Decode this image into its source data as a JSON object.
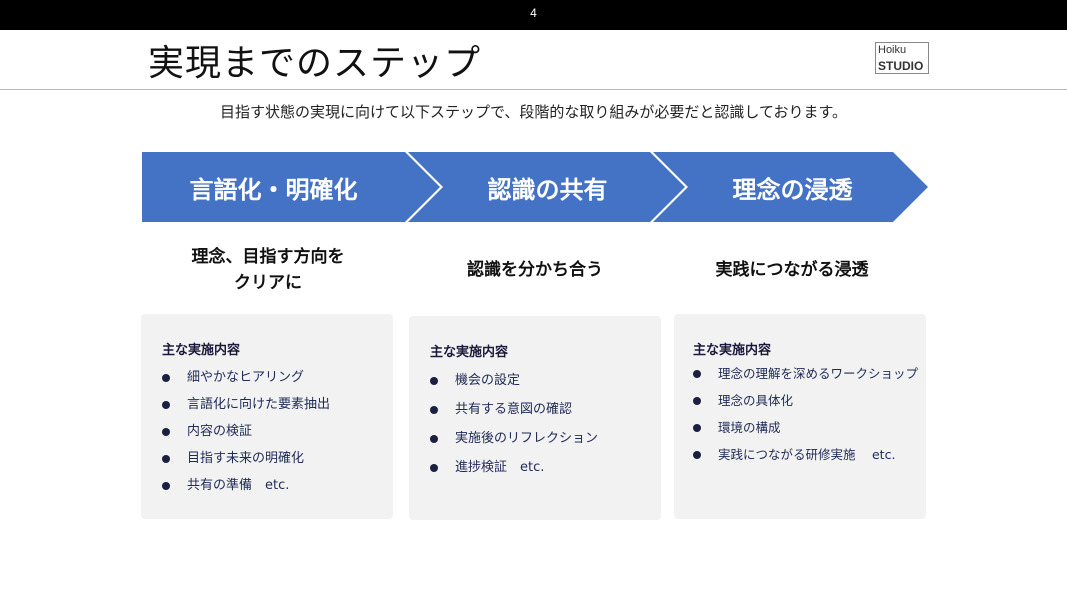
{
  "page_number": "4",
  "title": "実現までのステップ",
  "logo": {
    "line1": "Hoiku",
    "line2": "STUDIO"
  },
  "subtitle": "目指す状態の実現に向けて以下ステップで、段階的な取り組みが必要だと認識しております。",
  "colors": {
    "arrow": "#4472c4",
    "card": "#f2f2f2",
    "bullet_text": "#1f2a55"
  },
  "steps": [
    {
      "label": "言語化・明確化",
      "heading_lines": [
        "理念、目指す方向を",
        "クリアに"
      ],
      "card_title": "主な実施内容",
      "items": [
        "細やかなヒアリング",
        "言語化に向けた要素抽出",
        "内容の検証",
        "目指す未来の明確化",
        "共有の準備　etc."
      ]
    },
    {
      "label": "認識の共有",
      "heading_lines": [
        "認識を分かち合う"
      ],
      "card_title": "主な実施内容",
      "items": [
        "機会の設定",
        "共有する意図の確認",
        "実施後のリフレクション",
        "進捗検証　etc."
      ]
    },
    {
      "label": "理念の浸透",
      "heading_lines": [
        "実践につながる浸透"
      ],
      "card_title": "主な実施内容",
      "items": [
        "理念の理解を深めるワークショップ",
        "理念の具体化",
        "環境の構成",
        "実践につながる研修実施　 etc."
      ]
    }
  ]
}
